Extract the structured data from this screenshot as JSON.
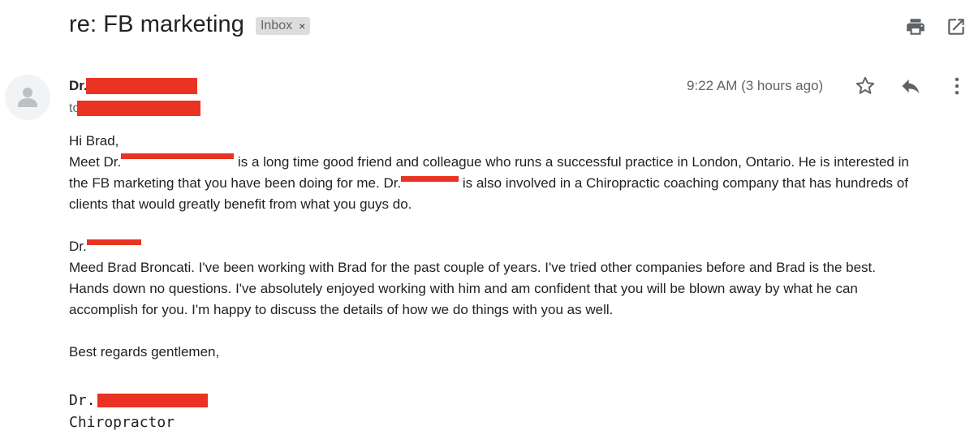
{
  "subject": "re: FB marketing",
  "label_chip": {
    "label": "Inbox",
    "remove_glyph": "×"
  },
  "toolbar": {
    "print_icon": "print-icon",
    "popout_icon": "open-in-new-window-icon"
  },
  "header": {
    "sender_prefix": "Dr.",
    "to_prefix": "to",
    "time": "9:22 AM (3 hours ago)",
    "icons": [
      "star-icon",
      "reply-icon",
      "more-vert-icon"
    ]
  },
  "body": {
    "greeting": "Hi Brad,",
    "p1_l1_a": "Meet Dr.",
    "p1_l1_b": " is a long time good friend and colleague who runs a successful practice in London, Ontario. He is interested in",
    "p1_l2_a": "the FB marketing that you have been doing for me. Dr.",
    "p1_l2_b": " is also involved in a Chiropractic coaching company that has hundreds of",
    "p1_l3": "clients that would greatly benefit from what you guys do.",
    "p2_salutation": "Dr.",
    "p2_l1": "Meed Brad Broncati. I've been working with Brad for the past couple of years. I've tried other companies before and Brad is the best.",
    "p2_l2": "Hands down no questions. I've absolutely enjoyed working with him and am confident that you will be blown away by what he can",
    "p2_l3": "accomplish for you. I'm happy to discuss the details of how we do things with you as well.",
    "closing": "Best regards gentlemen,"
  },
  "signature": {
    "name_prefix": "Dr.",
    "title": "Chiropractor"
  },
  "colors": {
    "redaction": "#ea3323",
    "icon": "#5f6368",
    "chip_bg": "#dddddd"
  }
}
